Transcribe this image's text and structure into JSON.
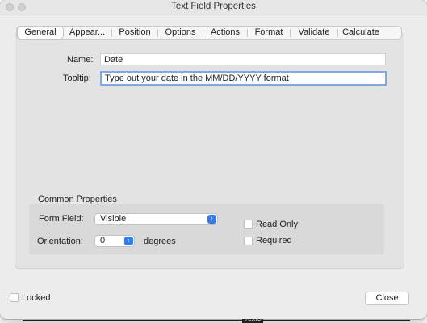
{
  "window": {
    "title": "Text Field Properties"
  },
  "tabs": [
    {
      "label": "General",
      "active": true
    },
    {
      "label": "Appear..."
    },
    {
      "label": "Position"
    },
    {
      "label": "Options"
    },
    {
      "label": "Actions"
    },
    {
      "label": "Format"
    },
    {
      "label": "Validate"
    },
    {
      "label": "Calculate"
    }
  ],
  "general": {
    "name_label": "Name:",
    "name_value": "Date",
    "tooltip_label": "Tooltip:",
    "tooltip_value": "Type out your date in the MM/DD/YYYY format"
  },
  "common": {
    "section_title": "Common Properties",
    "form_field_label": "Form Field:",
    "form_field_value": "Visible",
    "orientation_label": "Orientation:",
    "orientation_value": "0",
    "degrees_label": "degrees",
    "read_only_label": "Read Only",
    "read_only_checked": false,
    "required_label": "Required",
    "required_checked": false
  },
  "footer": {
    "locked_label": "Locked",
    "locked_checked": false,
    "close_label": "Close"
  },
  "background": {
    "label": "Text3"
  },
  "icons": {
    "popup": "up-down-chevron-icon"
  },
  "colors": {
    "accent": "#2f7bf5",
    "focus_ring": "#7aa9f0"
  }
}
